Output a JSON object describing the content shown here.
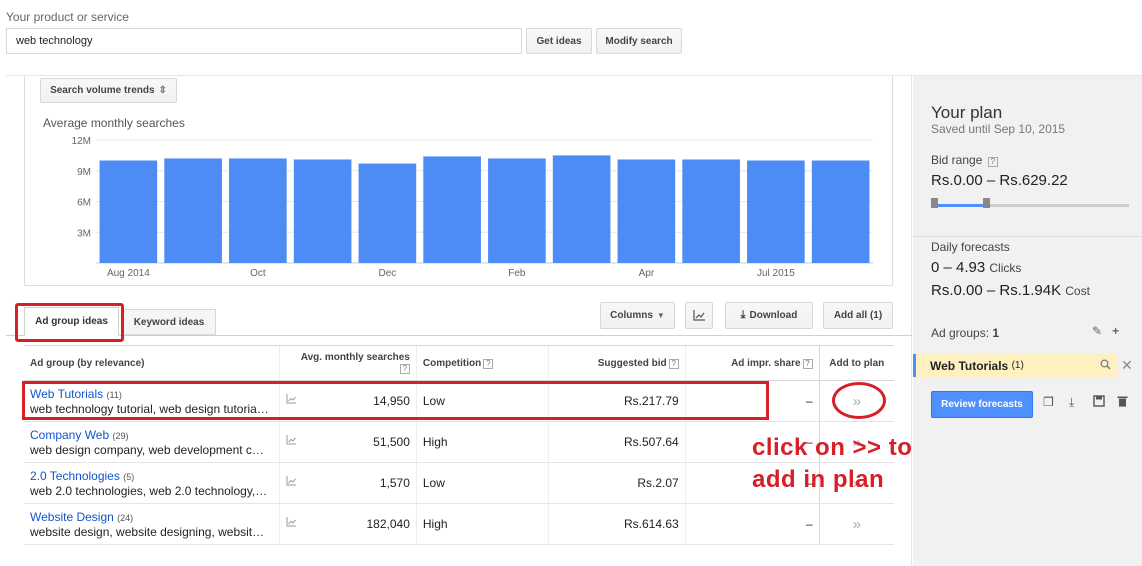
{
  "search": {
    "label": "Your product or service",
    "value": "web technology",
    "get_ideas": "Get ideas",
    "modify_search": "Modify search"
  },
  "chart_controls": {
    "trend_select": "Search volume trends",
    "trend_select_icon": "updown-icon"
  },
  "chart_data": {
    "type": "bar",
    "title": "Average monthly searches",
    "categories": [
      "Aug 2014",
      "Sep 2014",
      "Oct 2014",
      "Nov 2014",
      "Dec 2014",
      "Jan 2015",
      "Feb 2015",
      "Mar 2015",
      "Apr 2015",
      "May 2015",
      "Jun 2015",
      "Jul 2015"
    ],
    "x_tick_labels": [
      "Aug 2014",
      "",
      "Oct",
      "",
      "Dec",
      "",
      "Feb",
      "",
      "Apr",
      "",
      "Jul 2015",
      ""
    ],
    "values": [
      10.0,
      10.2,
      10.2,
      10.1,
      9.7,
      10.4,
      10.2,
      10.5,
      10.1,
      10.1,
      10.0,
      10.0
    ],
    "y_ticks": [
      "3M",
      "6M",
      "9M",
      "12M"
    ],
    "y_tick_values": [
      3,
      6,
      9,
      12
    ],
    "ylim": [
      0,
      12
    ],
    "unit": "M",
    "grid": true,
    "bar_color": "#4d8cf4"
  },
  "tabs": {
    "ad_group": "Ad group ideas",
    "keyword": "Keyword ideas"
  },
  "toolbar": {
    "columns": "Columns",
    "download": "Download",
    "add_all": "Add all (1)"
  },
  "table": {
    "headers": {
      "ad_group": "Ad group (by relevance)",
      "searches": "Avg. monthly searches",
      "competition": "Competition",
      "bid": "Suggested bid",
      "share": "Ad impr. share",
      "add": "Add to plan"
    },
    "rows": [
      {
        "name": "Web Tutorials",
        "count": "(11)",
        "keywords": "web technology tutorial, web design tutoria…",
        "searches": "14,950",
        "competition": "Low",
        "bid": "Rs.217.79",
        "share": "–",
        "add": "»"
      },
      {
        "name": "Company Web",
        "count": "(29)",
        "keywords": "web design company, web development c…",
        "searches": "51,500",
        "competition": "High",
        "bid": "Rs.507.64",
        "share": "–",
        "add": "»"
      },
      {
        "name": "2.0 Technologies",
        "count": "(5)",
        "keywords": "web 2.0 technologies, web 2.0 technology,…",
        "searches": "1,570",
        "competition": "Low",
        "bid": "Rs.2.07",
        "share": "–",
        "add": "»"
      },
      {
        "name": "Website Design",
        "count": "(24)",
        "keywords": "website design, website designing, websit…",
        "searches": "182,040",
        "competition": "High",
        "bid": "Rs.614.63",
        "share": "–",
        "add": "»"
      }
    ]
  },
  "annotation": {
    "line1": "click on >> to",
    "line2": "add in plan",
    "color": "#d61f26"
  },
  "plan": {
    "title": "Your plan",
    "saved": "Saved until Sep 10, 2015",
    "bid_range_label": "Bid range",
    "bid_range_value": "Rs.0.00 – Rs.629.22",
    "daily_label": "Daily forecasts",
    "clicks_value": "0 – 4.93",
    "clicks_unit": "Clicks",
    "cost_value": "Rs.0.00 – Rs.1.94K",
    "cost_unit": "Cost",
    "ad_groups_label": "Ad groups:",
    "ad_groups_count": "1",
    "chip_name": "Web Tutorials",
    "chip_count": "(1)",
    "review_button": "Review forecasts",
    "accent": "#4d90fe"
  }
}
